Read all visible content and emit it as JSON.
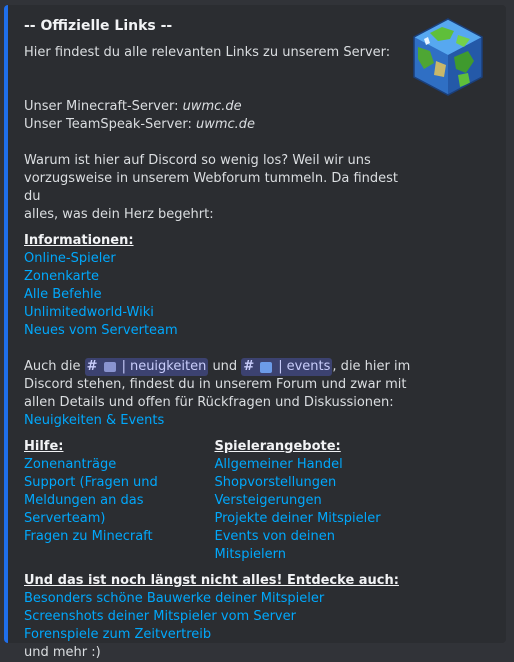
{
  "embed": {
    "title": "-- Offizielle Links --",
    "intro": "Hier findest du alle relevanten Links zu unserem Server:",
    "mc_label": "Unser Minecraft-Server: ",
    "mc_value": "uwmc.de",
    "ts_label": "Unser TeamSpeak-Server: ",
    "ts_value": "uwmc.de",
    "why_line1": "Warum ist hier auf Discord so wenig los? Weil wir uns",
    "why_line2": "vorzugsweise in unserem Webforum tummeln. Da findest du",
    "why_line3": "alles, was dein Herz begehrt:",
    "accent_color": "#1f6feb",
    "link_color": "#00a8fc"
  },
  "informationen": {
    "heading": "Informationen:",
    "links": [
      "Online-Spieler",
      "Zonenkarte",
      "Alle Befehle",
      "Unlimitedworld-Wiki",
      "Neues vom Serverteam"
    ]
  },
  "channels": {
    "prefix": "Auch die ",
    "channel1": "neuigkeiten",
    "middle": " und ",
    "channel2": "events",
    "suffix": ", die hier im",
    "line2": "Discord stehen, findest du in unserem Forum und zwar mit",
    "line3": "allen Details und offen für Rückfragen und Diskussionen:",
    "link": "Neuigkeiten & Events",
    "hash": "#",
    "sep": "|"
  },
  "hilfe": {
    "heading": "Hilfe:",
    "links": [
      "Zonenanträge",
      "Support (Fragen und Meldungen an das Serverteam)",
      "Fragen zu Minecraft"
    ]
  },
  "spielerangebote": {
    "heading": "Spielerangebote:",
    "links": [
      "Allgemeiner Handel",
      "Shopvorstellungen",
      "Versteigerungen",
      "Projekte deiner Mitspieler",
      "Events von deinen Mitspielern"
    ]
  },
  "mehr": {
    "heading": "Und das ist noch längst nicht alles! Entdecke auch:",
    "links": [
      "Besonders schöne Bauwerke deiner Mitspieler",
      "Screenshots deiner Mitspieler vom Server",
      "Forenspiele zum Zeitvertreib"
    ],
    "outro": "und mehr :)"
  },
  "icons": {
    "thumbnail": "minecraft-globe-cube-icon",
    "channel1_emoji": "newspaper-icon",
    "channel2_emoji": "calendar-icon"
  }
}
